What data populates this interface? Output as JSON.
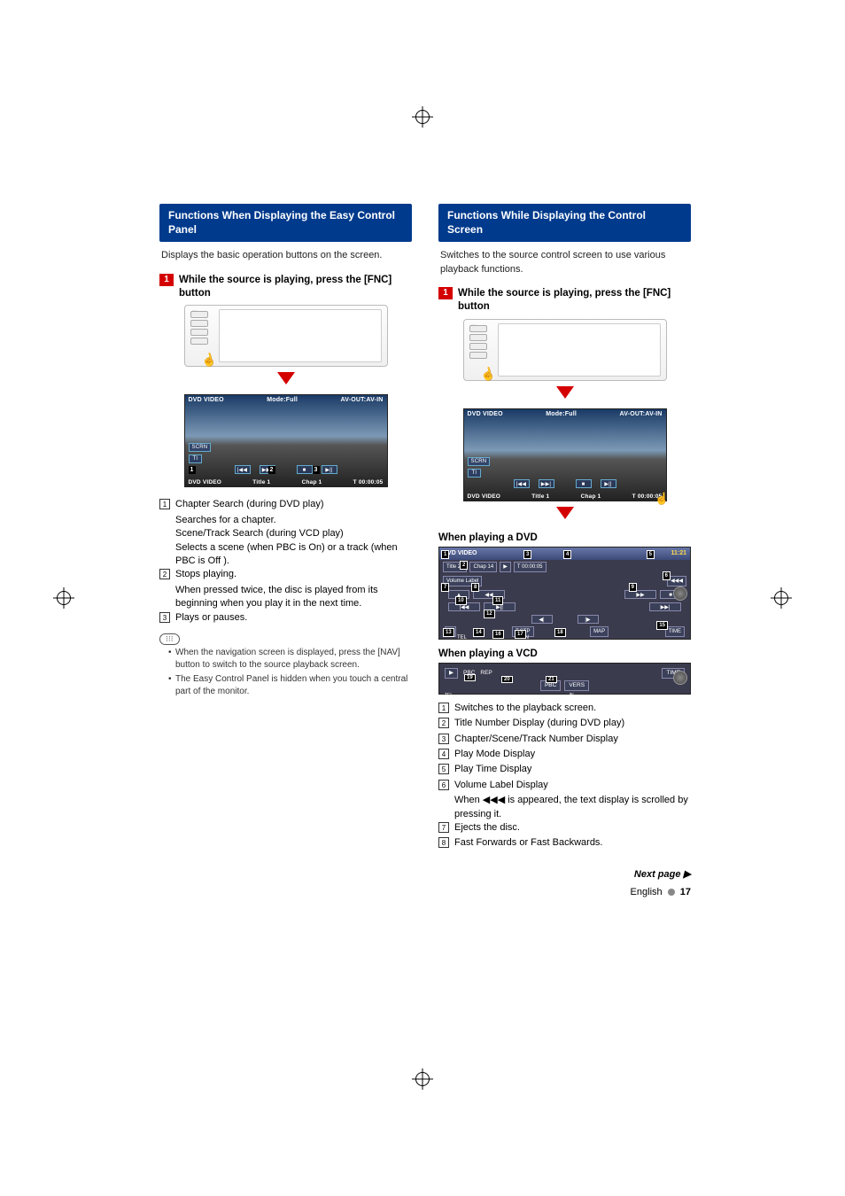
{
  "left": {
    "title": "Functions When Displaying the Easy Control Panel",
    "intro": "Displays the basic operation buttons on the screen.",
    "step_num": "1",
    "step_text": "While the source is playing, press the [FNC] button",
    "playback": {
      "label_dvd_video": "DVD VIDEO",
      "label_mode": "Mode:Full",
      "label_avout": "AV-OUT:AV-IN",
      "scrn": "SCRN",
      "ti": "TI",
      "btn_prev": "|◀◀",
      "btn_next": "▶▶|",
      "btn_stop": "■",
      "btn_play": "▶||",
      "bottom_src": "DVD VIDEO",
      "bottom_title_label": "Title",
      "bottom_title_val": "1",
      "bottom_chap_label": "Chap",
      "bottom_chap_val": "1",
      "bottom_time_label": "T",
      "bottom_time_val": "00:00:05",
      "callouts": {
        "c1": "1",
        "c2": "2",
        "c3": "3"
      }
    },
    "legend": {
      "r1n": "1",
      "r1a": "Chapter Search (during DVD play)",
      "r1b": "Searches for a chapter.",
      "r1c": "Scene/Track Search (during VCD play)",
      "r1d": "Selects a scene (when PBC is On) or a track (when PBC is Off ).",
      "r2n": "2",
      "r2a": "Stops playing.",
      "r2b": "When pressed twice, the disc is played from its beginning when you play it in the next time.",
      "r3n": "3",
      "r3a": "Plays or pauses."
    },
    "notes": {
      "n1": "When the navigation screen is displayed, press the [NAV] button to switch to the source playback screen.",
      "n2": "The Easy Control Panel is hidden when you touch a central part of the monitor."
    }
  },
  "right": {
    "title": "Functions While Displaying the Control Screen",
    "intro": "Switches to the source control screen to use various playback functions.",
    "step_num": "1",
    "step_text": "While the source is playing, press the [FNC] button",
    "playback": {
      "label_dvd_video": "DVD VIDEO",
      "label_mode": "Mode:Full",
      "label_avout": "AV-OUT:AV-IN",
      "scrn": "SCRN",
      "ti": "TI",
      "btn_prev": "|◀◀",
      "btn_next": "▶▶|",
      "btn_stop": "■",
      "btn_play": "▶||",
      "bottom_src": "DVD VIDEO",
      "bottom_title_label": "Title",
      "bottom_title_val": "1",
      "bottom_chap_label": "Chap",
      "bottom_chap_val": "1",
      "bottom_time_label": "T",
      "bottom_time_val": "00:00:05"
    },
    "dvd_heading": "When playing a DVD",
    "dvd_panel": {
      "top_label": "DVD VIDEO",
      "clock": "11:21",
      "title_lbl": "Title",
      "title_val": "25",
      "chap_lbl": "Chap",
      "chap_val": "14",
      "play": "▶",
      "time_lbl": "T",
      "time_val": "00:00:05",
      "volume_label": "Volume Label",
      "scroll": "◀◀◀",
      "eject": "▲",
      "rw": "◀◀",
      "ff": "▶▶",
      "stop": "■",
      "prev": "|◀◀",
      "playpause": "▶||",
      "next": "▶▶|",
      "step_back": "◀|",
      "step_fwd": "|▶",
      "play_icon": "▶",
      "tstp": "T.STP",
      "map": "MAP",
      "tel": "TEL",
      "in": "IN",
      "time_btn": "TIME",
      "callouts": {
        "1": "1",
        "2": "2",
        "3": "3",
        "4": "4",
        "5": "5",
        "6": "6",
        "7": "7",
        "8": "8",
        "9": "9",
        "10": "10",
        "11": "11",
        "12": "12",
        "13": "13",
        "14": "14",
        "15": "15",
        "16": "16",
        "17": "17",
        "18": "18",
        "19": "19",
        "20": "20",
        "21": "21"
      }
    },
    "vcd_heading": "When playing a VCD",
    "vcd_panel": {
      "play": "▶",
      "pbc": "PBC",
      "rep": "REP",
      "pbc_btn": "PBC",
      "vers": "VERS",
      "time_btn": "TIME",
      "tel": "TEL",
      "in": "IN",
      "callouts": {
        "19": "19",
        "20": "20",
        "21": "21"
      }
    },
    "legend": {
      "r1n": "1",
      "r1": "Switches to the playback screen.",
      "r2n": "2",
      "r2": "Title Number Display (during DVD play)",
      "r3n": "3",
      "r3": "Chapter/Scene/Track Number Display",
      "r4n": "4",
      "r4": "Play Mode Display",
      "r5n": "5",
      "r5": "Play Time Display",
      "r6n": "6",
      "r6": "Volume Label Display",
      "r6b": "When ◀◀◀ is appeared, the text display is scrolled by pressing it.",
      "r7n": "7",
      "r7": "Ejects the disc.",
      "r8n": "8",
      "r8": "Fast Forwards or Fast Backwards."
    },
    "nextpage": "Next page ▶",
    "footer_lang": "English",
    "footer_page": "17"
  }
}
